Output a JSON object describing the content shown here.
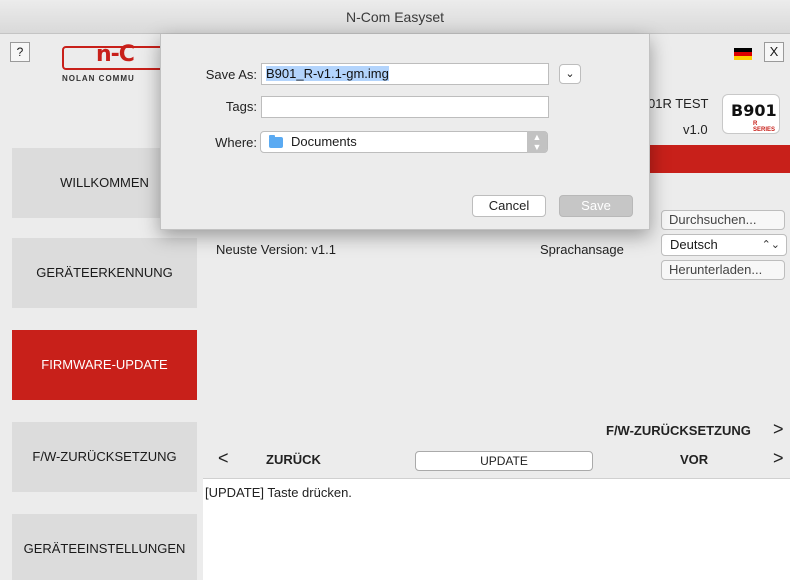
{
  "window": {
    "title": "N-Com Easyset"
  },
  "app": {
    "help_label": "?",
    "close_label": "X",
    "logo": {
      "mark": "n-C",
      "subtitle": "NOLAN COMMU"
    },
    "device": {
      "name": "01R TEST",
      "version": "v1.0",
      "badge": "B901",
      "badge_sub": "R SERIES"
    },
    "flag_colors": [
      "#000000",
      "#dd0000",
      "#ffce00"
    ]
  },
  "sidebar": {
    "items": [
      {
        "label": "WILLKOMMEN"
      },
      {
        "label": "GERÄTEERKENNUNG"
      },
      {
        "label": "FIRMWARE-UPDATE",
        "active": true
      },
      {
        "label": "F/W-ZURÜCKSETZUNG"
      },
      {
        "label": "GERÄTEEINSTELLUNGEN"
      }
    ]
  },
  "main": {
    "browse_label": "Durchsuchen...",
    "latest_version": "Neuste Version: v1.1",
    "voice_label": "Sprachansage",
    "language": "Deutsch",
    "download_label": "Herunterladen...",
    "fw_reset_link": "F/W-ZURÜCKSETZUNG",
    "fw_reset_arrow": ">",
    "back_arrow": "<",
    "back_label": "ZURÜCK",
    "update_label": "UPDATE",
    "next_label": "VOR",
    "next_arrow": ">",
    "log_text": "[UPDATE] Taste drücken."
  },
  "dialog": {
    "save_as_label": "Save As:",
    "filename": "B901_R-v1.1-gm.img",
    "tags_label": "Tags:",
    "tags_value": "",
    "where_label": "Where:",
    "where_value": "Documents",
    "cancel_label": "Cancel",
    "save_label": "Save"
  },
  "colors": {
    "accent": "#c8201a"
  }
}
